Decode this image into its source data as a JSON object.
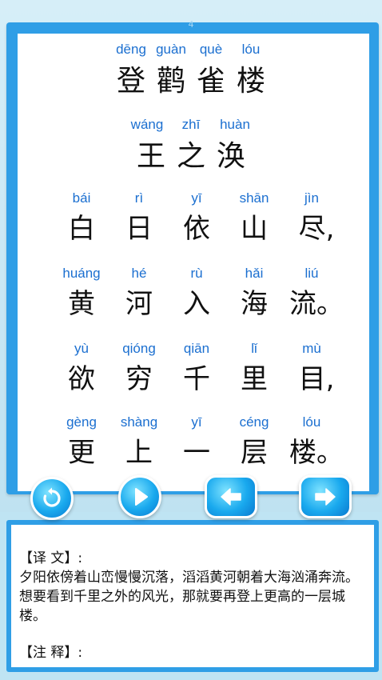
{
  "page_number": "4",
  "title": {
    "pinyin": [
      "dēng",
      "guàn",
      "què",
      "lóu"
    ],
    "hanzi": [
      "登",
      "鹳",
      "雀",
      "楼"
    ]
  },
  "author": {
    "pinyin": [
      "wáng",
      "zhī",
      "huàn"
    ],
    "hanzi": [
      "王",
      "之",
      "涣"
    ]
  },
  "lines": [
    {
      "pinyin": [
        "bái",
        "rì",
        "yī",
        "shān",
        "jìn"
      ],
      "hanzi": [
        "白",
        "日",
        "依",
        "山",
        "尽,"
      ]
    },
    {
      "pinyin": [
        "huáng",
        "hé",
        "rù",
        "hǎi",
        "liú"
      ],
      "hanzi": [
        "黄",
        "河",
        "入",
        "海",
        "流。"
      ]
    },
    {
      "pinyin": [
        "yù",
        "qióng",
        "qiān",
        "lǐ",
        "mù"
      ],
      "hanzi": [
        "欲",
        "穷",
        "千",
        "里",
        "目,"
      ]
    },
    {
      "pinyin": [
        "gèng",
        "shàng",
        "yī",
        "céng",
        "lóu"
      ],
      "hanzi": [
        "更",
        "上",
        "一",
        "层",
        "楼。"
      ]
    }
  ],
  "controls": {
    "replay_icon": "replay-icon",
    "play_icon": "play-icon",
    "prev_icon": "arrow-left-icon",
    "next_icon": "arrow-right-icon"
  },
  "notes": {
    "translation_heading": "【译 文】:",
    "translation_text": "夕阳依傍着山峦慢慢沉落，滔滔黄河朝着大海汹涌奔流。想要看到千里之外的风光，那就要再登上更高的一层城楼。",
    "annotation_heading": "【注 释】:"
  },
  "colors": {
    "frame_blue": "#2f9ee6",
    "pinyin_blue": "#1b6fd0",
    "background": "#bfe4f3"
  }
}
